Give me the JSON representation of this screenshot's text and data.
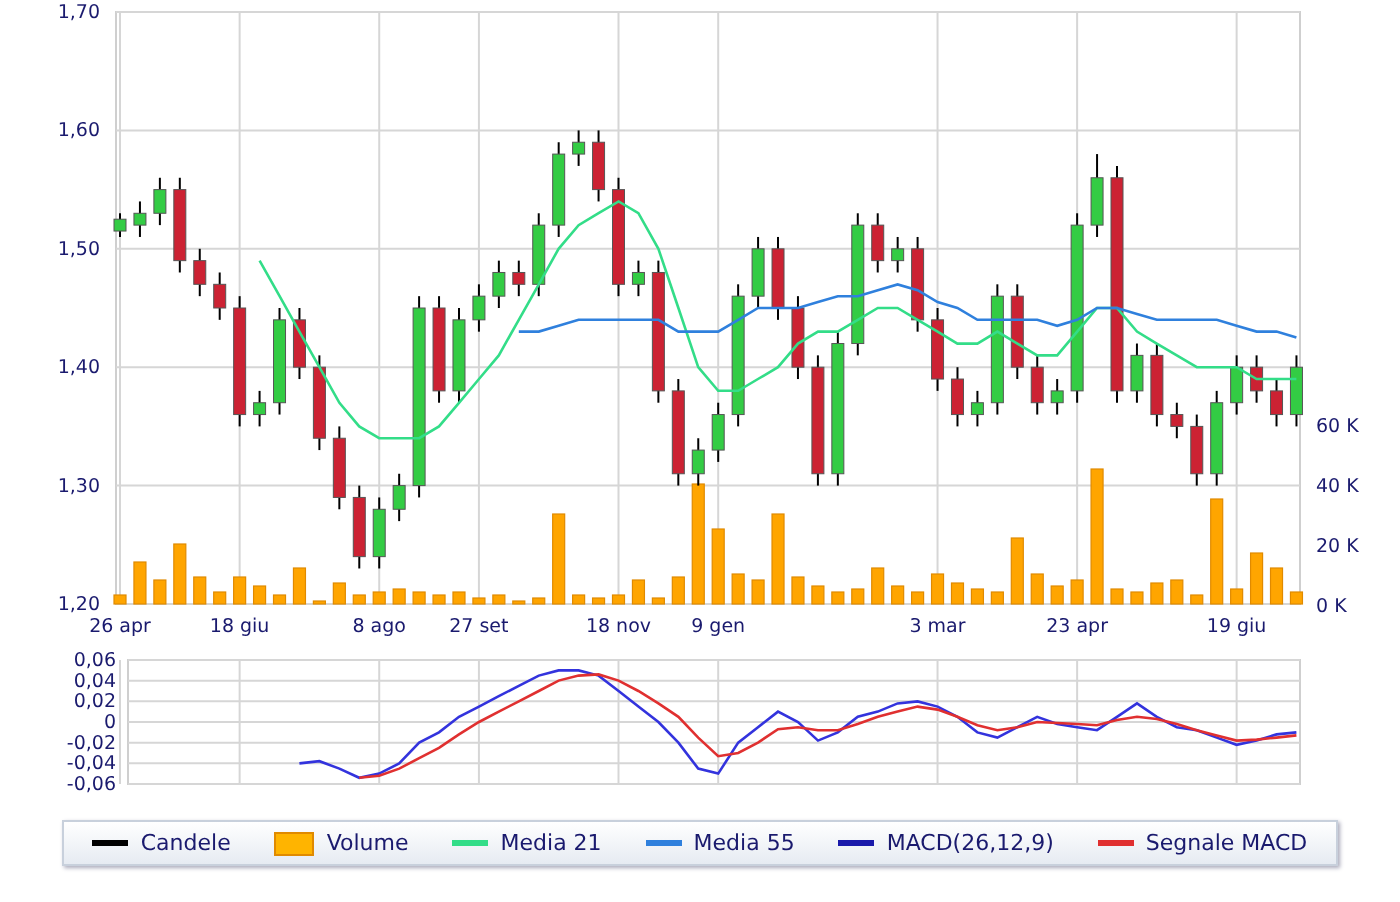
{
  "price_chart": {
    "chart_data": {
      "type": "candlestick",
      "grid": true,
      "categories": [
        "26 apr",
        null,
        null,
        null,
        null,
        null,
        "18 giu",
        null,
        null,
        null,
        null,
        null,
        null,
        "8 ago",
        null,
        null,
        null,
        null,
        "27 set",
        null,
        null,
        null,
        null,
        null,
        null,
        "18 nov",
        null,
        null,
        null,
        null,
        "9 gen",
        null,
        null,
        null,
        null,
        null,
        null,
        null,
        null,
        null,
        null,
        "3 mar",
        null,
        null,
        null,
        null,
        null,
        null,
        "23 apr",
        null,
        null,
        null,
        null,
        null,
        null,
        null,
        "19 giu",
        null,
        null,
        null
      ],
      "ylim": [
        1.2,
        1.7
      ],
      "yticks": [
        {
          "value": 1.2,
          "label": "1,20"
        },
        {
          "value": 1.3,
          "label": "1,30"
        },
        {
          "value": 1.4,
          "label": "1,40"
        },
        {
          "value": 1.5,
          "label": "1,50"
        },
        {
          "value": 1.6,
          "label": "1,60"
        },
        {
          "value": 1.7,
          "label": "1,70"
        }
      ],
      "ohlc": [
        [
          1.515,
          1.53,
          1.51,
          1.525
        ],
        [
          1.52,
          1.54,
          1.51,
          1.53
        ],
        [
          1.53,
          1.56,
          1.52,
          1.55
        ],
        [
          1.55,
          1.56,
          1.48,
          1.49
        ],
        [
          1.49,
          1.5,
          1.46,
          1.47
        ],
        [
          1.47,
          1.48,
          1.44,
          1.45
        ],
        [
          1.45,
          1.46,
          1.35,
          1.36
        ],
        [
          1.36,
          1.38,
          1.35,
          1.37
        ],
        [
          1.37,
          1.45,
          1.36,
          1.44
        ],
        [
          1.44,
          1.45,
          1.39,
          1.4
        ],
        [
          1.4,
          1.41,
          1.33,
          1.34
        ],
        [
          1.34,
          1.35,
          1.28,
          1.29
        ],
        [
          1.29,
          1.3,
          1.23,
          1.24
        ],
        [
          1.24,
          1.29,
          1.23,
          1.28
        ],
        [
          1.28,
          1.31,
          1.27,
          1.3
        ],
        [
          1.3,
          1.46,
          1.29,
          1.45
        ],
        [
          1.45,
          1.46,
          1.37,
          1.38
        ],
        [
          1.38,
          1.45,
          1.37,
          1.44
        ],
        [
          1.44,
          1.47,
          1.43,
          1.46
        ],
        [
          1.46,
          1.49,
          1.45,
          1.48
        ],
        [
          1.48,
          1.49,
          1.46,
          1.47
        ],
        [
          1.47,
          1.53,
          1.46,
          1.52
        ],
        [
          1.52,
          1.59,
          1.51,
          1.58
        ],
        [
          1.58,
          1.6,
          1.57,
          1.59
        ],
        [
          1.59,
          1.6,
          1.54,
          1.55
        ],
        [
          1.55,
          1.56,
          1.46,
          1.47
        ],
        [
          1.47,
          1.49,
          1.46,
          1.48
        ],
        [
          1.48,
          1.49,
          1.37,
          1.38
        ],
        [
          1.38,
          1.39,
          1.3,
          1.31
        ],
        [
          1.31,
          1.34,
          1.3,
          1.33
        ],
        [
          1.33,
          1.37,
          1.32,
          1.36
        ],
        [
          1.36,
          1.47,
          1.35,
          1.46
        ],
        [
          1.46,
          1.51,
          1.45,
          1.5
        ],
        [
          1.5,
          1.51,
          1.44,
          1.45
        ],
        [
          1.45,
          1.46,
          1.39,
          1.4
        ],
        [
          1.4,
          1.41,
          1.3,
          1.31
        ],
        [
          1.31,
          1.43,
          1.3,
          1.42
        ],
        [
          1.42,
          1.53,
          1.41,
          1.52
        ],
        [
          1.52,
          1.53,
          1.48,
          1.49
        ],
        [
          1.49,
          1.51,
          1.48,
          1.5
        ],
        [
          1.5,
          1.51,
          1.43,
          1.44
        ],
        [
          1.44,
          1.45,
          1.38,
          1.39
        ],
        [
          1.39,
          1.4,
          1.35,
          1.36
        ],
        [
          1.36,
          1.38,
          1.35,
          1.37
        ],
        [
          1.37,
          1.47,
          1.36,
          1.46
        ],
        [
          1.46,
          1.47,
          1.39,
          1.4
        ],
        [
          1.4,
          1.41,
          1.36,
          1.37
        ],
        [
          1.37,
          1.39,
          1.36,
          1.38
        ],
        [
          1.38,
          1.53,
          1.37,
          1.52
        ],
        [
          1.52,
          1.58,
          1.51,
          1.56
        ],
        [
          1.56,
          1.57,
          1.37,
          1.38
        ],
        [
          1.38,
          1.42,
          1.37,
          1.41
        ],
        [
          1.41,
          1.42,
          1.35,
          1.36
        ],
        [
          1.36,
          1.37,
          1.34,
          1.35
        ],
        [
          1.35,
          1.36,
          1.3,
          1.31
        ],
        [
          1.31,
          1.38,
          1.3,
          1.37
        ],
        [
          1.37,
          1.41,
          1.36,
          1.4
        ],
        [
          1.4,
          1.41,
          1.37,
          1.38
        ],
        [
          1.38,
          1.39,
          1.35,
          1.36
        ],
        [
          1.36,
          1.41,
          1.35,
          1.4
        ]
      ]
    }
  },
  "averages_chart": {
    "chart_data": {
      "type": "line",
      "categories": [
        null,
        null,
        null,
        null,
        null,
        null,
        null,
        null,
        null,
        null,
        null,
        null,
        null,
        null,
        null,
        null,
        null,
        null,
        null,
        null,
        null,
        null,
        null,
        null,
        null,
        null,
        null,
        null,
        null,
        null,
        null,
        null,
        null,
        null,
        null,
        null,
        null,
        null,
        null,
        null,
        null,
        null,
        null,
        null,
        null,
        null,
        null,
        null,
        null,
        null,
        null,
        null,
        null,
        null,
        null,
        null,
        null,
        null,
        null,
        null
      ],
      "ylim": [
        1.2,
        1.7
      ],
      "series": [
        {
          "color": "#33dd88",
          "values": [
            null,
            null,
            null,
            null,
            null,
            null,
            null,
            1.49,
            1.46,
            1.43,
            1.4,
            1.37,
            1.35,
            1.34,
            1.34,
            1.34,
            1.35,
            1.37,
            1.39,
            1.41,
            1.44,
            1.47,
            1.5,
            1.52,
            1.53,
            1.54,
            1.53,
            1.5,
            1.45,
            1.4,
            1.38,
            1.38,
            1.39,
            1.4,
            1.42,
            1.43,
            1.43,
            1.44,
            1.45,
            1.45,
            1.44,
            1.43,
            1.42,
            1.42,
            1.43,
            1.42,
            1.41,
            1.41,
            1.43,
            1.45,
            1.45,
            1.43,
            1.42,
            1.41,
            1.4,
            1.4,
            1.4,
            1.39,
            1.39,
            1.39
          ]
        },
        {
          "color": "#2f80dd",
          "values": [
            null,
            null,
            null,
            null,
            null,
            null,
            null,
            null,
            null,
            null,
            null,
            null,
            null,
            null,
            null,
            null,
            null,
            null,
            null,
            null,
            1.43,
            1.43,
            1.435,
            1.44,
            1.44,
            1.44,
            1.44,
            1.44,
            1.43,
            1.43,
            1.43,
            1.44,
            1.45,
            1.45,
            1.45,
            1.455,
            1.46,
            1.46,
            1.465,
            1.47,
            1.465,
            1.455,
            1.45,
            1.44,
            1.44,
            1.44,
            1.44,
            1.435,
            1.44,
            1.45,
            1.45,
            1.445,
            1.44,
            1.44,
            1.44,
            1.44,
            1.435,
            1.43,
            1.43,
            1.425
          ]
        }
      ]
    }
  },
  "volume_chart": {
    "chart_data": {
      "type": "bar",
      "categories": [
        null,
        null,
        null,
        null,
        null,
        null,
        null,
        null,
        null,
        null,
        null,
        null,
        null,
        null,
        null,
        null,
        null,
        null,
        null,
        null,
        null,
        null,
        null,
        null,
        null,
        null,
        null,
        null,
        null,
        null,
        null,
        null,
        null,
        null,
        null,
        null,
        null,
        null,
        null,
        null,
        null,
        null,
        null,
        null,
        null,
        null,
        null,
        null,
        null,
        null,
        null,
        null,
        null,
        null,
        null,
        null,
        null,
        null,
        null,
        null
      ],
      "ylim": [
        0,
        60
      ],
      "yticks": [
        {
          "value": 0,
          "label": "0 K"
        },
        {
          "value": 20,
          "label": "20 K"
        },
        {
          "value": 40,
          "label": "40 K"
        },
        {
          "value": 60,
          "label": "60 K"
        }
      ],
      "series": [
        {
          "color": "#ffa500",
          "values": [
            3,
            14,
            8,
            20,
            9,
            4,
            9,
            6,
            3,
            12,
            1,
            7,
            3,
            4,
            5,
            4,
            3,
            4,
            2,
            3,
            1,
            2,
            30,
            3,
            2,
            3,
            8,
            2,
            9,
            40,
            25,
            10,
            8,
            30,
            9,
            6,
            4,
            5,
            12,
            6,
            4,
            10,
            7,
            5,
            4,
            22,
            10,
            6,
            8,
            45,
            5,
            4,
            7,
            8,
            3,
            35,
            5,
            17,
            12,
            4
          ]
        }
      ]
    }
  },
  "macd_chart": {
    "chart_data": {
      "type": "line",
      "grid": true,
      "categories": [
        null,
        null,
        null,
        null,
        null,
        null,
        null,
        null,
        null,
        null,
        null,
        null,
        null,
        null,
        null,
        null,
        null,
        null,
        null,
        null,
        null,
        null,
        null,
        null,
        null,
        null,
        null,
        null,
        null,
        null,
        null,
        null,
        null,
        null,
        null,
        null,
        null,
        null,
        null,
        null,
        null,
        null,
        null,
        null,
        null,
        null,
        null,
        null,
        null,
        null,
        null,
        null,
        null,
        null,
        null,
        null,
        null,
        null,
        null,
        null
      ],
      "ylim": [
        -0.06,
        0.06
      ],
      "yticks": [
        {
          "value": -0.06,
          "label": "-0,06"
        },
        {
          "value": -0.04,
          "label": "-0,04"
        },
        {
          "value": -0.02,
          "label": "-0,02"
        },
        {
          "value": 0,
          "label": "0"
        },
        {
          "value": 0.02,
          "label": "0,02"
        },
        {
          "value": 0.04,
          "label": "0,04"
        },
        {
          "value": 0.06,
          "label": "0,06"
        }
      ],
      "series": [
        {
          "color": "#3333dd",
          "values": [
            null,
            null,
            null,
            null,
            null,
            null,
            null,
            null,
            null,
            -0.04,
            -0.038,
            -0.045,
            -0.054,
            -0.05,
            -0.04,
            -0.02,
            -0.01,
            0.005,
            0.015,
            0.025,
            0.035,
            0.045,
            0.05,
            0.05,
            0.045,
            0.03,
            0.015,
            0,
            -0.02,
            -0.045,
            -0.05,
            -0.02,
            -0.005,
            0.01,
            0,
            -0.018,
            -0.01,
            0.005,
            0.01,
            0.018,
            0.02,
            0.015,
            0.005,
            -0.01,
            -0.015,
            -0.005,
            0.005,
            -0.002,
            -0.005,
            -0.008,
            0.005,
            0.018,
            0.005,
            -0.005,
            -0.008,
            -0.015,
            -0.022,
            -0.018,
            -0.012,
            -0.01
          ]
        },
        {
          "color": "#e03030",
          "values": [
            null,
            null,
            null,
            null,
            null,
            null,
            null,
            null,
            null,
            null,
            null,
            null,
            -0.054,
            -0.052,
            -0.045,
            -0.035,
            -0.025,
            -0.012,
            0,
            0.01,
            0.02,
            0.03,
            0.04,
            0.045,
            0.046,
            0.04,
            0.03,
            0.018,
            0.005,
            -0.015,
            -0.033,
            -0.03,
            -0.02,
            -0.007,
            -0.005,
            -0.008,
            -0.008,
            -0.002,
            0.005,
            0.01,
            0.015,
            0.012,
            0.005,
            -0.003,
            -0.008,
            -0.005,
            0,
            -0.001,
            -0.002,
            -0.003,
            0.002,
            0.005,
            0.003,
            -0.002,
            -0.008,
            -0.013,
            -0.018,
            -0.017,
            -0.015,
            -0.013
          ]
        }
      ]
    }
  },
  "legend": [
    {
      "label": "Candele",
      "kind": "line",
      "color": "#000000"
    },
    {
      "label": "Volume",
      "kind": "area",
      "color": "#ffb400"
    },
    {
      "label": "Media 21",
      "kind": "line",
      "color": "#33dd88"
    },
    {
      "label": "Media 55",
      "kind": "line",
      "color": "#2f80dd"
    },
    {
      "label": "MACD(26,12,9)",
      "kind": "line",
      "color": "#1a1aaa"
    },
    {
      "label": "Segnale MACD",
      "kind": "line",
      "color": "#e03030"
    }
  ]
}
